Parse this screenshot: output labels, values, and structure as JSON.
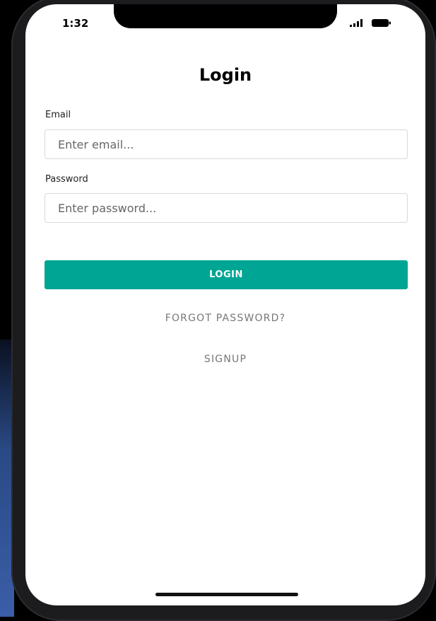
{
  "status_bar": {
    "time": "1:32",
    "signal_icon": "cellular-signal-icon",
    "battery_icon": "battery-icon"
  },
  "login_screen": {
    "title": "Login",
    "email": {
      "label": "Email",
      "value": "",
      "placeholder": "Enter email..."
    },
    "password": {
      "label": "Password",
      "value": "",
      "placeholder": "Enter password..."
    },
    "login_button_label": "LOGIN",
    "forgot_password_label": "FORGOT PASSWORD?",
    "signup_label": "SIGNUP"
  },
  "colors": {
    "accent": "#00a594",
    "background": "#000000",
    "screen": "#ffffff",
    "muted_text": "#777777"
  }
}
